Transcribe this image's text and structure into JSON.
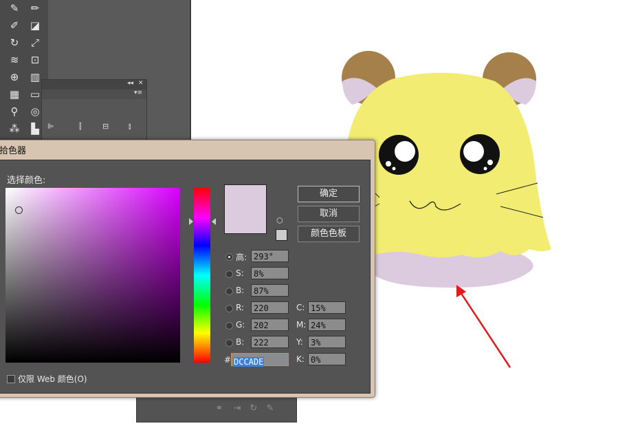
{
  "tools": [
    {
      "icon": "paintbrush-icon",
      "glyph": "✎"
    },
    {
      "icon": "pencil-icon",
      "glyph": "✏"
    },
    {
      "icon": "blob-brush-icon",
      "glyph": "✐"
    },
    {
      "icon": "eraser-icon",
      "glyph": "◪"
    },
    {
      "icon": "rotate-icon",
      "glyph": "↻"
    },
    {
      "icon": "scale-icon",
      "glyph": "⤢"
    },
    {
      "icon": "width-tool-icon",
      "glyph": "≋"
    },
    {
      "icon": "free-transform-icon",
      "glyph": "⊡"
    },
    {
      "icon": "shape-builder-icon",
      "glyph": "⊕"
    },
    {
      "icon": "perspective-grid-icon",
      "glyph": "▥"
    },
    {
      "icon": "mesh-icon",
      "glyph": "▦"
    },
    {
      "icon": "gradient-icon",
      "glyph": "▭"
    },
    {
      "icon": "eyedropper-icon",
      "glyph": "⚲"
    },
    {
      "icon": "blend-icon",
      "glyph": "◎"
    },
    {
      "icon": "symbol-sprayer-icon",
      "glyph": "⁂"
    },
    {
      "icon": "column-graph-icon",
      "glyph": "▙"
    }
  ],
  "dialog": {
    "title": "拾色器",
    "select_label": "选择颜色:",
    "buttons": {
      "ok": "确定",
      "cancel": "取消",
      "swatches": "颜色色板"
    },
    "new_color": "#dccade",
    "web_color": "#cccccc",
    "fields": {
      "H": {
        "label": "高:",
        "value": "293°"
      },
      "S": {
        "label": "S:",
        "value": "8%"
      },
      "B": {
        "label": "B:",
        "value": "87%"
      },
      "R": {
        "label": "R:",
        "value": "220"
      },
      "G": {
        "label": "G:",
        "value": "202"
      },
      "Bl": {
        "label": "B:",
        "value": "222"
      },
      "C": {
        "label": "C:",
        "value": "15%"
      },
      "M": {
        "label": "M:",
        "value": "24%"
      },
      "Y": {
        "label": "Y:",
        "value": "3%"
      },
      "K": {
        "label": "K:",
        "value": "0%"
      }
    },
    "hex_symbol": "#",
    "hex": "DCCADE",
    "web_only_label": "仅限 Web 颜色(O)"
  },
  "artwork": {
    "body_color": "#f2ec73",
    "ear_color": "#a5804a",
    "inner_ear_color": "#dccade",
    "skirt_color": "#dccade",
    "arrow_color": "#e01b1b"
  }
}
